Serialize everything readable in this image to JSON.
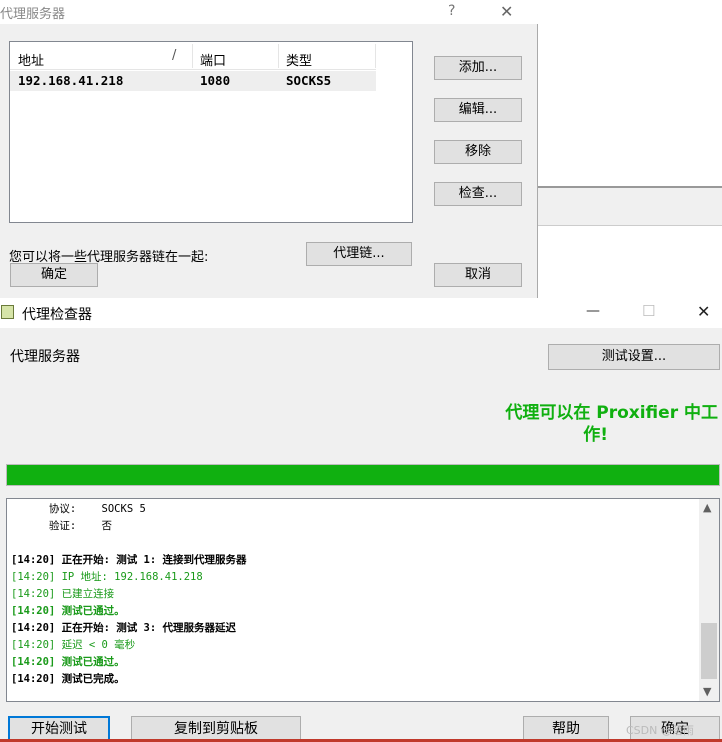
{
  "proxy_dialog": {
    "title": "代理服务器",
    "help_glyph": "?",
    "close_glyph": "✕",
    "columns": [
      "地址",
      "端口",
      "类型"
    ],
    "row": {
      "address": "192.168.41.218",
      "port": "1080",
      "type": "SOCKS5"
    },
    "add_label": "添加...",
    "edit_label": "编辑...",
    "remove_label": "移除",
    "check_label": "检查...",
    "chain_hint": "您可以将一些代理服务器链在一起:",
    "chain_label": "代理链...",
    "ok_label": "确定",
    "cancel_label": "取消"
  },
  "checker": {
    "title": "代理检查器",
    "minimize_glyph": "—",
    "maximize_glyph": "☐",
    "close_glyph": "✕",
    "section_label": "代理服务器",
    "test_settings_label": "测试设置...",
    "status_line1": "代理可以在 Proxifier 中工",
    "status_line2": "作!",
    "progress": 1.0,
    "progress_color": "#10b010",
    "log": [
      {
        "text": "      协议:    SOCKS 5",
        "style": "plain"
      },
      {
        "text": "      验证:    否",
        "style": "plain"
      },
      {
        "text": "",
        "style": "plain"
      },
      {
        "text": "[14:20] 正在开始: 测试 1: 连接到代理服务器",
        "style": "bold"
      },
      {
        "text": "[14:20] IP 地址: 192.168.41.218",
        "style": "green"
      },
      {
        "text": "[14:20] 已建立连接",
        "style": "green"
      },
      {
        "text": "[14:20] 测试已通过。",
        "style": "greenbold"
      },
      {
        "text": "[14:20] 正在开始: 测试 3: 代理服务器延迟",
        "style": "bold"
      },
      {
        "text": "[14:20] 延迟 < 0 毫秒",
        "style": "green"
      },
      {
        "text": "[14:20] 测试已通过。",
        "style": "greenbold"
      },
      {
        "text": "[14:20] 测试已完成。",
        "style": "bold"
      }
    ],
    "start_label": "开始测试",
    "copy_label": "复制到剪贴板",
    "help_label": "帮助",
    "ok_label": "确定",
    "watermark": "CSDN @落雨"
  }
}
